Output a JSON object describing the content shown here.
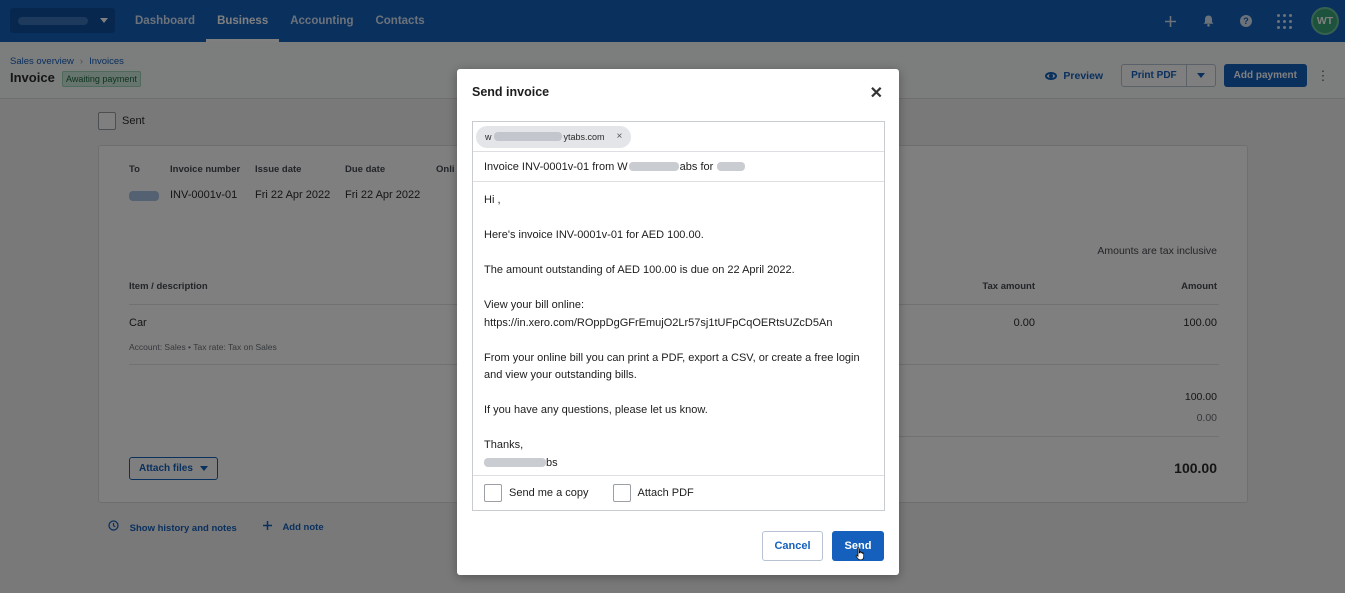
{
  "topnav": {
    "org_label": "",
    "links": [
      {
        "label": "Dashboard",
        "active": false
      },
      {
        "label": "Business",
        "active": true
      },
      {
        "label": "Accounting",
        "active": false
      },
      {
        "label": "Contacts",
        "active": false
      }
    ],
    "icons": [
      "plus-icon",
      "bell-icon",
      "help-icon",
      "apps-grid-icon"
    ],
    "help_glyph": "?",
    "avatar_initials": "WT",
    "brand_color": "#1560bd"
  },
  "header": {
    "breadcrumbs": [
      "Sales overview",
      "Invoices"
    ],
    "breadcrumb_sep": "›",
    "title": "Invoice",
    "status": "Awaiting payment",
    "preview_label": "Preview",
    "print_pdf_label": "Print PDF",
    "add_payment_label": "Add payment",
    "more_glyph": "⋮"
  },
  "background": {
    "sent_label": "Sent",
    "columns": {
      "to": "To",
      "invoice_number": "Invoice number",
      "issue_date": "Issue date",
      "due_date": "Due date",
      "online": "Onli"
    },
    "values": {
      "invoice_number": "INV-0001v-01",
      "issue_date": "Fri 22 Apr 2022",
      "due_date": "Fri 22 Apr 2022"
    },
    "tax_note": "Amounts are tax inclusive",
    "items_header": {
      "description": "Item / description",
      "tax_amount": "Tax amount",
      "amount": "Amount"
    },
    "item": {
      "name": "Car",
      "meta": "Account: Sales • Tax rate: Tax on Sales",
      "tax_amount": "0.00",
      "amount": "100.00"
    },
    "subtotal": "100.00",
    "tax_total": "0.00",
    "total": "100.00",
    "attach_label": "Attach files",
    "history_label": "Show history and notes",
    "add_note_label": "Add note"
  },
  "modal": {
    "title": "Send invoice",
    "close_glyph": "✕",
    "recipient_prefix": "w",
    "recipient_suffix": "ytabs.com",
    "recipient_remove": "×",
    "subject_prefix": "Invoice INV-0001v-01 from W",
    "subject_mid": "abs for",
    "body": {
      "greeting": "Hi ,",
      "line1": "Here's invoice INV-0001v-01 for AED 100.00.",
      "line2": "The amount outstanding of AED 100.00 is due on 22 April 2022.",
      "view_label": "View your bill online:",
      "url": "https://in.xero.com/ROppDgGFrEmujO2Lr57sj1tUFpCqOERtsUZcD5An",
      "line3a": "From your online bill you can print a PDF, export a CSV, or create a free login",
      "line3b": "and view your outstanding bills.",
      "line4": "If you have any questions, please let us know.",
      "thanks": "Thanks,",
      "sign_suffix": "bs"
    },
    "send_copy_label": "Send me a copy",
    "attach_pdf_label": "Attach PDF",
    "cancel_label": "Cancel",
    "send_label": "Send"
  }
}
